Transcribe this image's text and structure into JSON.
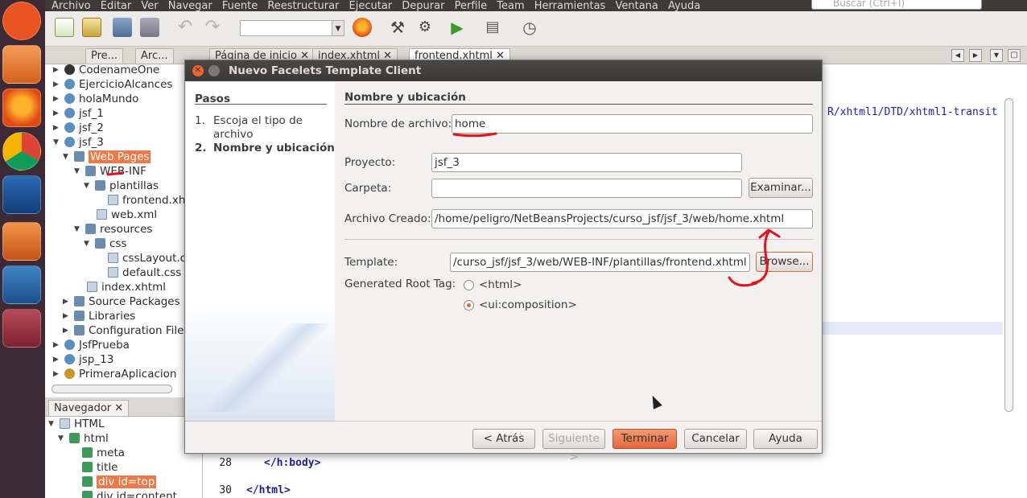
{
  "menubar": {
    "items": [
      "Archivo",
      "Editar",
      "Ver",
      "Navegar",
      "Fuente",
      "Reestructurar",
      "Ejecutar",
      "Depurar",
      "Perfile",
      "Team",
      "Herramientas",
      "Ventana",
      "Ayuda"
    ],
    "search_placeholder": "Buscar (Ctrl+I)"
  },
  "project_tabs": [
    "Pre...",
    "Arc..."
  ],
  "project_tree": [
    {
      "label": "CodenameOne",
      "icon": "codename-icon"
    },
    {
      "label": "EjercicioAlcances",
      "icon": "globe-project-icon"
    },
    {
      "label": "holaMundo",
      "icon": "globe-project-icon"
    },
    {
      "label": "jsf_1",
      "icon": "globe-project-icon"
    },
    {
      "label": "jsf_2",
      "icon": "globe-project-icon"
    },
    {
      "label": "jsf_3",
      "icon": "globe-project-icon"
    },
    {
      "label": "Web Pages",
      "icon": "folder-icon"
    },
    {
      "label": "WEB-INF",
      "icon": "folder-icon"
    },
    {
      "label": "plantillas",
      "icon": "folder-icon"
    },
    {
      "label": "frontend.xhtml",
      "icon": "file-icon"
    },
    {
      "label": "web.xml",
      "icon": "file-icon"
    },
    {
      "label": "resources",
      "icon": "folder-icon"
    },
    {
      "label": "css",
      "icon": "folder-icon"
    },
    {
      "label": "cssLayout.css",
      "icon": "file-icon"
    },
    {
      "label": "default.css",
      "icon": "file-icon"
    },
    {
      "label": "index.xhtml",
      "icon": "file-icon"
    },
    {
      "label": "Source Packages",
      "icon": "package-icon"
    },
    {
      "label": "Libraries",
      "icon": "library-icon"
    },
    {
      "label": "Configuration Files",
      "icon": "config-icon"
    },
    {
      "label": "JsfPrueba",
      "icon": "globe-project-icon"
    },
    {
      "label": "jsp_13",
      "icon": "globe-project-icon"
    },
    {
      "label": "PrimeraAplicacion",
      "icon": "coffee-project-icon"
    }
  ],
  "navigator": {
    "tab": "Navegador",
    "items": [
      "HTML",
      "html",
      "meta",
      "title",
      "div id=top",
      "div id=content"
    ]
  },
  "editor": {
    "tabs": [
      "Página de inicio",
      "index.xhtml",
      "frontend.xhtml"
    ],
    "code_fragment": "R/xhtml1/DTD/xhtml1-transit",
    "lines": [
      {
        "num": "28",
        "code": "</h:body>"
      },
      {
        "num": "30",
        "code": "</html>"
      }
    ]
  },
  "dialog": {
    "title": "Nuevo  Facelets Template Client",
    "steps_header": "Pasos",
    "steps": [
      {
        "num": "1.",
        "label": "Escoja el tipo de archivo"
      },
      {
        "num": "2.",
        "label": "Nombre y ubicación"
      }
    ],
    "section_title": "Nombre y ubicación",
    "file_name_label": "Nombre de archivo:",
    "file_name_value": "home",
    "project_label": "Proyecto:",
    "project_value": "jsf_3",
    "folder_label": "Carpeta:",
    "folder_value": "",
    "browse_folder_button": "Examinar...",
    "created_file_label": "Archivo Creado:",
    "created_file_value": "/home/peligro/NetBeansProjects/curso_jsf/jsf_3/web/home.xhtml",
    "template_label": "Template:",
    "template_value": "/curso_jsf/jsf_3/web/WEB-INF/plantillas/frontend.xhtml",
    "browse_template_button": "Browse...",
    "root_tag_label": "Generated Root Tag:",
    "root_tag_options": [
      "<html>",
      "<ui:composition>"
    ],
    "buttons": {
      "back": "< Atrás",
      "next": "Siguiente >",
      "finish": "Terminar",
      "cancel": "Cancelar",
      "help": "Ayuda"
    }
  },
  "colors": {
    "accent": "#e5673b",
    "annotation": "#e8101a",
    "titlebar": "#3c3b37",
    "launcher": "#3c2a35"
  }
}
